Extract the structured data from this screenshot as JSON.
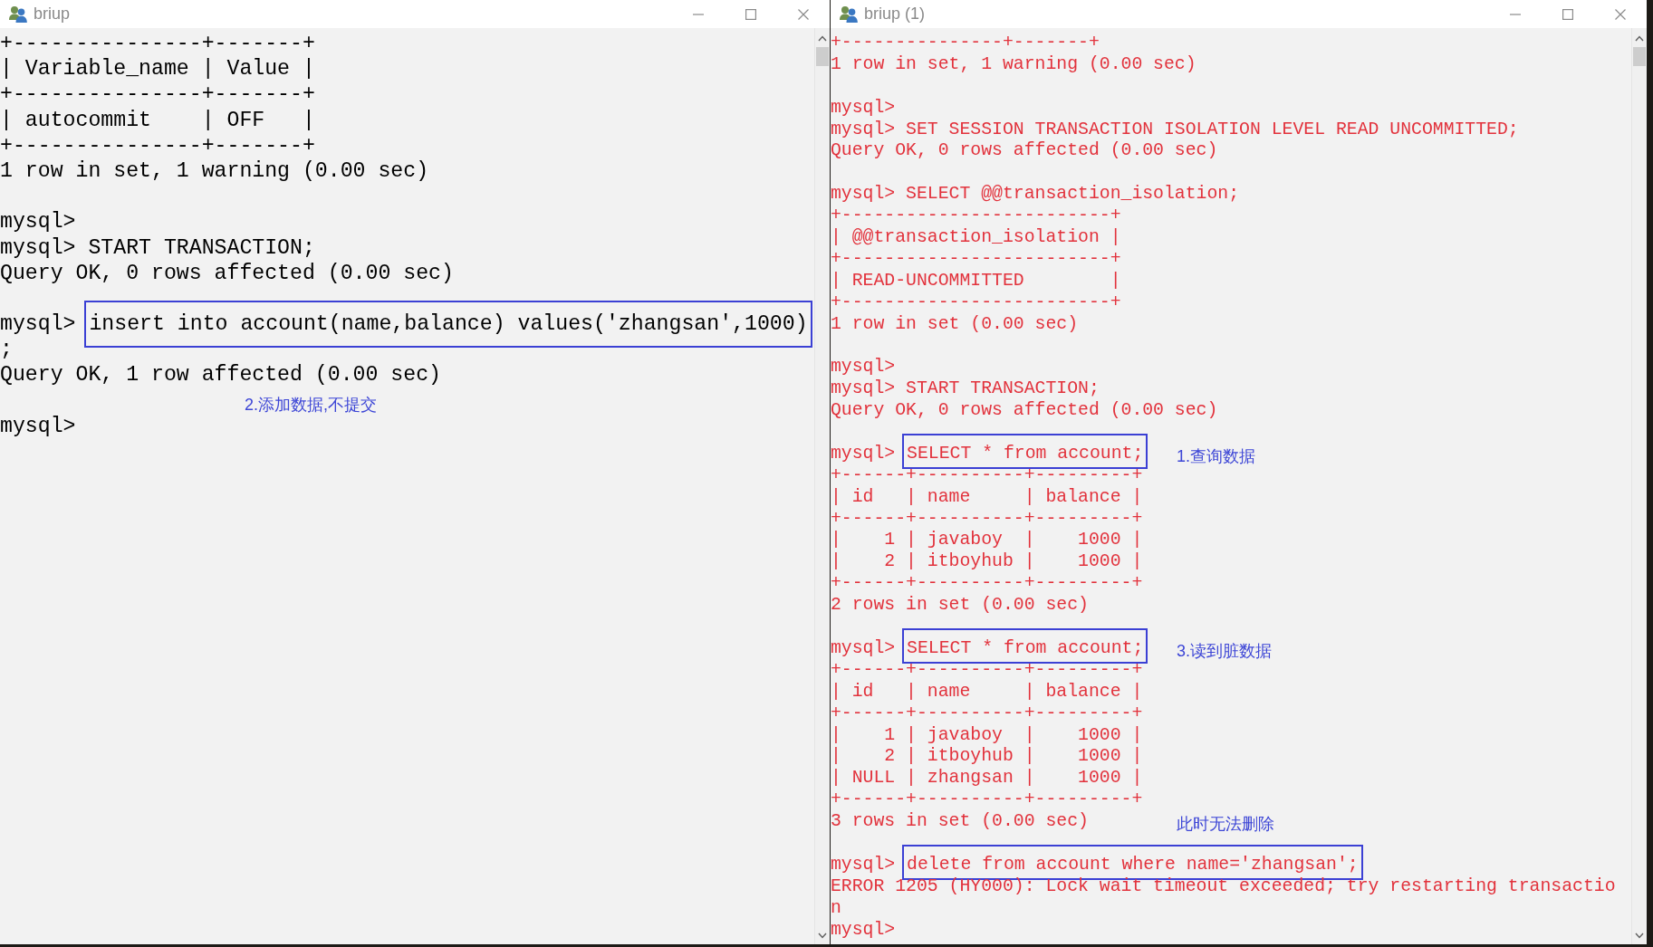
{
  "windows": [
    {
      "title": "briup",
      "color": "#000000",
      "lines": [
        {
          "kind": "text",
          "text": "+---------------+-------+"
        },
        {
          "kind": "text",
          "text": "| Variable_name | Value |"
        },
        {
          "kind": "text",
          "text": "+---------------+-------+"
        },
        {
          "kind": "text",
          "text": "| autocommit    | OFF   |"
        },
        {
          "kind": "text",
          "text": "+---------------+-------+"
        },
        {
          "kind": "text",
          "text": "1 row in set, 1 warning (0.00 sec)"
        },
        {
          "kind": "blank"
        },
        {
          "kind": "text",
          "text": "mysql>"
        },
        {
          "kind": "text",
          "text": "mysql> START TRANSACTION;"
        },
        {
          "kind": "text",
          "text": "Query OK, 0 rows affected (0.00 sec)"
        },
        {
          "kind": "blank"
        },
        {
          "kind": "boxed",
          "prompt": "mysql>",
          "command": "insert into account(name,balance) values('zhangsan',1000)"
        },
        {
          "kind": "text",
          "text": ";"
        },
        {
          "kind": "text",
          "text": "Query OK, 1 row affected (0.00 sec)"
        },
        {
          "kind": "blank",
          "note": "2.添加数据,不提交"
        },
        {
          "kind": "text",
          "text": "mysql>"
        }
      ]
    },
    {
      "title": "briup (1)",
      "color": "#e2323c",
      "lines": [
        {
          "kind": "text",
          "text": "+---------------+-------+"
        },
        {
          "kind": "text",
          "text": "1 row in set, 1 warning (0.00 sec)"
        },
        {
          "kind": "blank"
        },
        {
          "kind": "text",
          "text": "mysql>"
        },
        {
          "kind": "text",
          "text": "mysql> SET SESSION TRANSACTION ISOLATION LEVEL READ UNCOMMITTED;"
        },
        {
          "kind": "text",
          "text": "Query OK, 0 rows affected (0.00 sec)"
        },
        {
          "kind": "blank"
        },
        {
          "kind": "text",
          "text": "mysql> SELECT @@transaction_isolation;"
        },
        {
          "kind": "text",
          "text": "+-------------------------+"
        },
        {
          "kind": "text",
          "text": "| @@transaction_isolation |"
        },
        {
          "kind": "text",
          "text": "+-------------------------+"
        },
        {
          "kind": "text",
          "text": "| READ-UNCOMMITTED        |"
        },
        {
          "kind": "text",
          "text": "+-------------------------+"
        },
        {
          "kind": "text",
          "text": "1 row in set (0.00 sec)"
        },
        {
          "kind": "blank"
        },
        {
          "kind": "text",
          "text": "mysql>"
        },
        {
          "kind": "text",
          "text": "mysql> START TRANSACTION;"
        },
        {
          "kind": "text",
          "text": "Query OK, 0 rows affected (0.00 sec)"
        },
        {
          "kind": "blank"
        },
        {
          "kind": "boxed",
          "prompt": "mysql>",
          "command": "SELECT * from account;",
          "note": "1.查询数据"
        },
        {
          "kind": "text",
          "text": "+------+----------+---------+"
        },
        {
          "kind": "text",
          "text": "| id   | name     | balance |"
        },
        {
          "kind": "text",
          "text": "+------+----------+---------+"
        },
        {
          "kind": "text",
          "text": "|    1 | javaboy  |    1000 |"
        },
        {
          "kind": "text",
          "text": "|    2 | itboyhub |    1000 |"
        },
        {
          "kind": "text",
          "text": "+------+----------+---------+"
        },
        {
          "kind": "text",
          "text": "2 rows in set (0.00 sec)"
        },
        {
          "kind": "blank"
        },
        {
          "kind": "boxed",
          "prompt": "mysql>",
          "command": "SELECT * from account;",
          "note": "3.读到脏数据"
        },
        {
          "kind": "text",
          "text": "+------+----------+---------+"
        },
        {
          "kind": "text",
          "text": "| id   | name     | balance |"
        },
        {
          "kind": "text",
          "text": "+------+----------+---------+"
        },
        {
          "kind": "text",
          "text": "|    1 | javaboy  |    1000 |"
        },
        {
          "kind": "text",
          "text": "|    2 | itboyhub |    1000 |"
        },
        {
          "kind": "text",
          "text": "| NULL | zhangsan |    1000 |"
        },
        {
          "kind": "text",
          "text": "+------+----------+---------+"
        },
        {
          "kind": "text",
          "text": "3 rows in set (0.00 sec)",
          "note": "此时无法删除"
        },
        {
          "kind": "blank"
        },
        {
          "kind": "boxed",
          "prompt": "mysql>",
          "command": "delete from account where name='zhangsan';"
        },
        {
          "kind": "text",
          "text": "ERROR 1205 (HY000): Lock wait timeout exceeded; try restarting transactio"
        },
        {
          "kind": "text",
          "text": "n"
        },
        {
          "kind": "text",
          "text": "mysql>"
        }
      ]
    }
  ]
}
